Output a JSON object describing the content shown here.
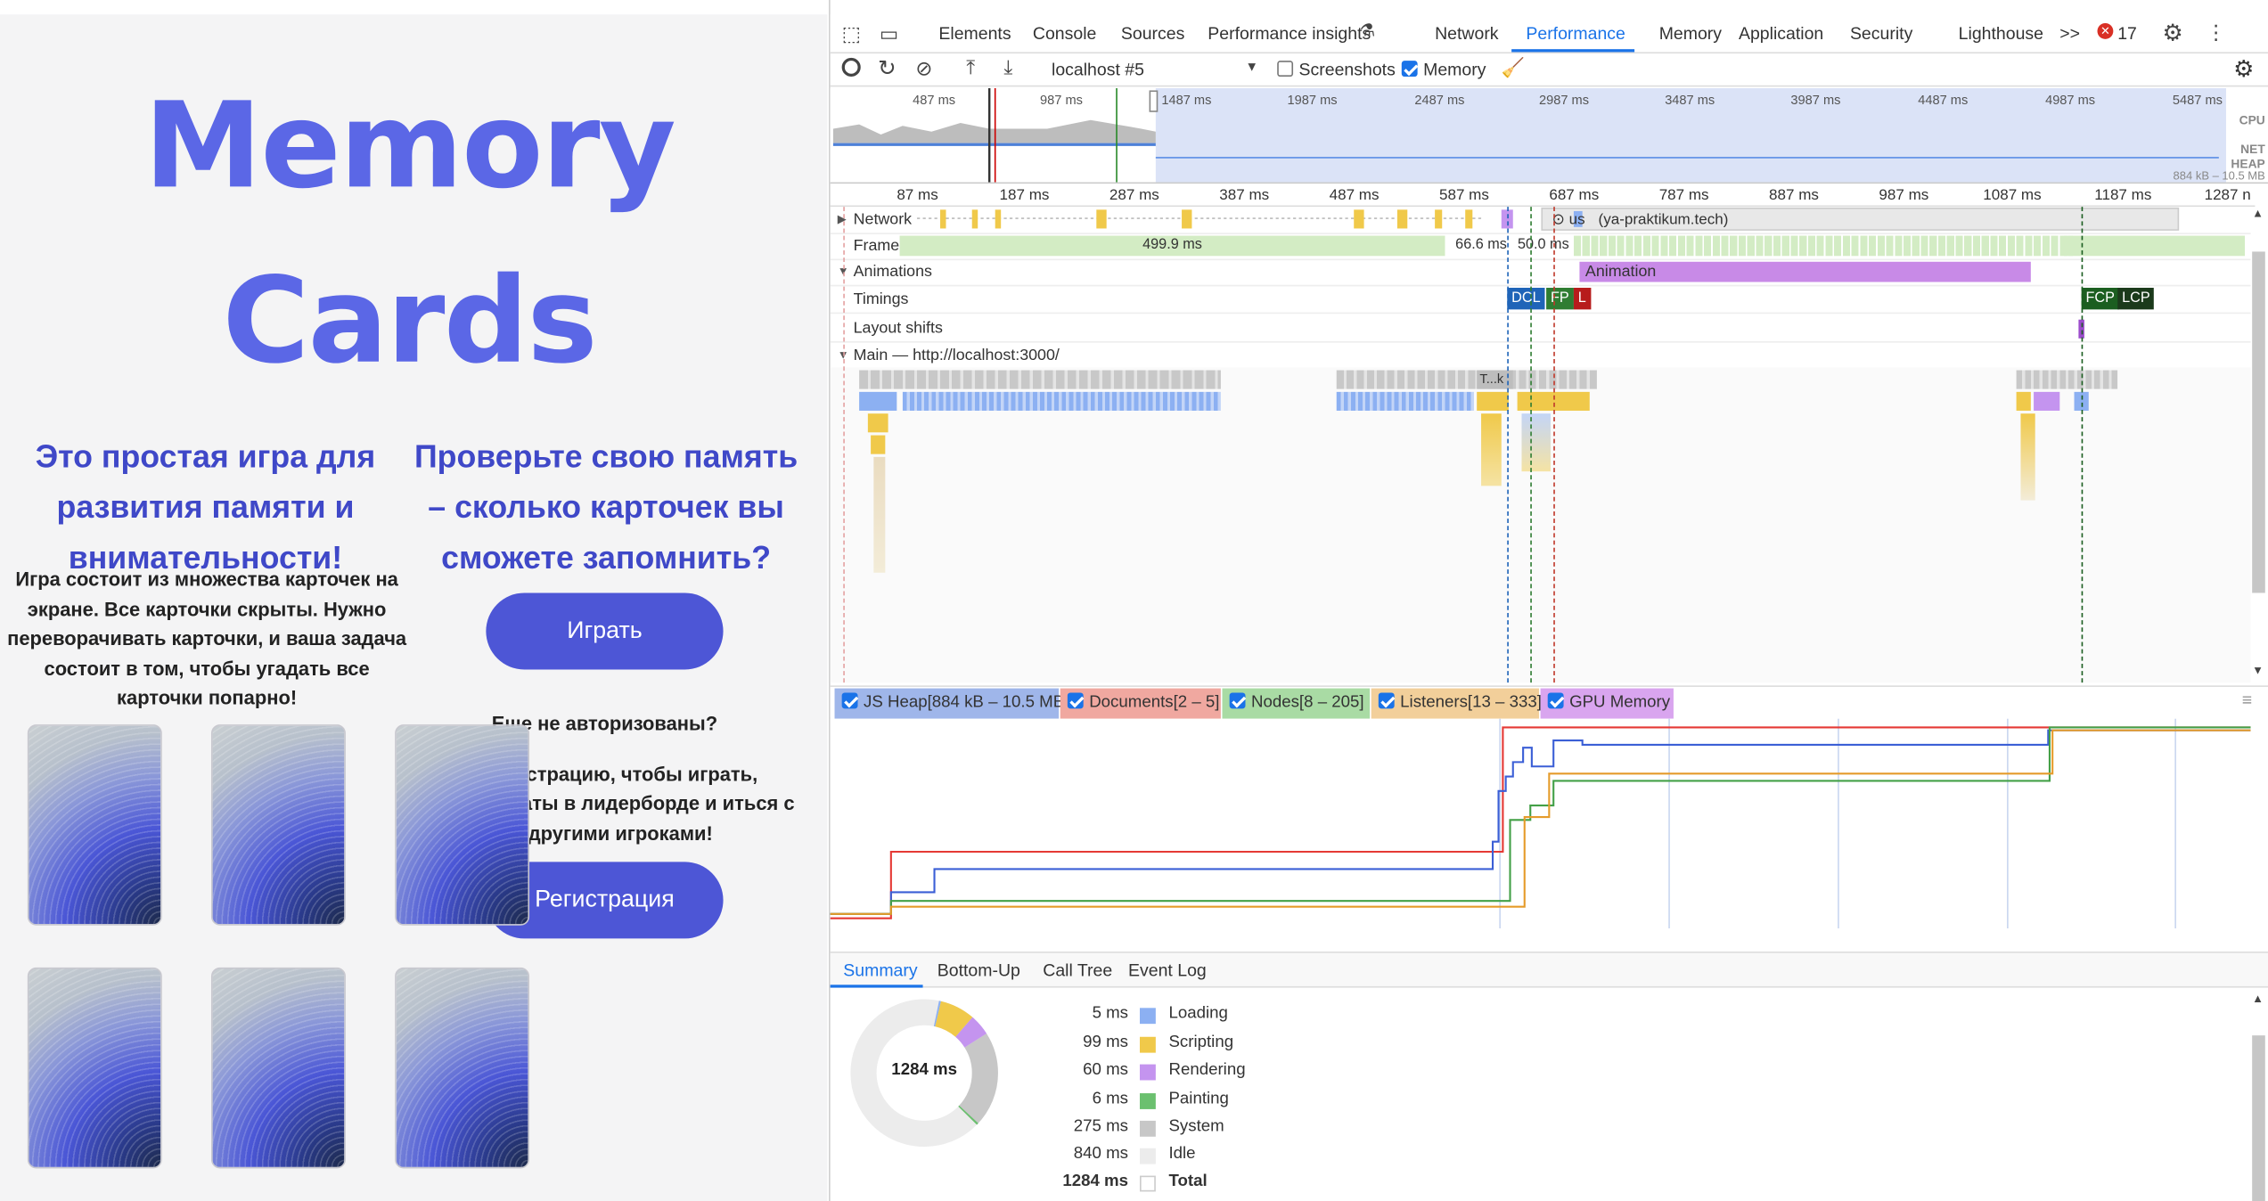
{
  "app": {
    "title_line1": "Memory",
    "title_line2": "Cards",
    "heading_left": "Это простая игра для развития памяти и внимательности!",
    "heading_right": "Проверьте свою память – сколько карточек вы сможете запомнить?",
    "description": "Игра состоит из множества карточек на экране. Все карточки скрыты. Нужно переворачивать карточки, и ваша задача состоит в том, чтобы угадать все карточки попарно!",
    "play_button": "Играть",
    "not_authorized": "Еще не авторизованы?",
    "register_prompt": "регистрацию, чтобы играть, результаты в лидерборде и иться с другими игроками!",
    "register_button": "Регистрация"
  },
  "devtools": {
    "tabs": [
      "Elements",
      "Console",
      "Sources",
      "Performance insights",
      "Network",
      "Performance",
      "Memory",
      "Application",
      "Security",
      "Lighthouse"
    ],
    "active_tab": "Performance",
    "more_tabs": ">>",
    "error_count": "17",
    "toolbar": {
      "target": "localhost #5",
      "screenshots_label": "Screenshots",
      "screenshots_checked": false,
      "memory_label": "Memory",
      "memory_checked": true
    },
    "overview": {
      "ticks": [
        "487 ms",
        "987 ms",
        "1487 ms",
        "1987 ms",
        "2487 ms",
        "2987 ms",
        "3487 ms",
        "3987 ms",
        "4487 ms",
        "4987 ms",
        "5487 ms"
      ],
      "labels": [
        "CPU",
        "NET",
        "HEAP"
      ],
      "heap_range": "884 kB – 10.5 MB"
    },
    "ruler": [
      "87 ms",
      "187 ms",
      "287 ms",
      "387 ms",
      "487 ms",
      "587 ms",
      "687 ms",
      "787 ms",
      "887 ms",
      "987 ms",
      "1087 ms",
      "1187 ms",
      "1287 n"
    ],
    "tracks": {
      "network": "Network",
      "network_item1": "us",
      "network_item2": "(ya-praktikum.tech)",
      "frames": "Frames",
      "frame_values": [
        "499.9 ms",
        "66.6 ms",
        "50.0 ms"
      ],
      "animations": "Animations",
      "animation_label": "Animation",
      "timings": "Timings",
      "timing_badges": [
        "DCL",
        "FP",
        "L",
        "FCP",
        "LCP"
      ],
      "layout_shifts": "Layout shifts",
      "main": "Main — http://localhost:3000/",
      "task_label": "T...k"
    },
    "memory_legend": [
      "JS Heap[884 kB – 10.5 MB]",
      "Documents[2 – 5]",
      "Nodes[8 – 205]",
      "Listeners[13 – 333]",
      "GPU Memory"
    ],
    "summary_tabs": [
      "Summary",
      "Bottom-Up",
      "Call Tree",
      "Event Log"
    ],
    "summary": {
      "total_center": "1284 ms",
      "rows": [
        {
          "ms": "5 ms",
          "name": "Loading",
          "color": "#8cb0f2"
        },
        {
          "ms": "99 ms",
          "name": "Scripting",
          "color": "#f0c94a"
        },
        {
          "ms": "60 ms",
          "name": "Rendering",
          "color": "#c494ef"
        },
        {
          "ms": "6 ms",
          "name": "Painting",
          "color": "#6bc06f"
        },
        {
          "ms": "275 ms",
          "name": "System",
          "color": "#c7c7c7"
        },
        {
          "ms": "840 ms",
          "name": "Idle",
          "color": "#ececec"
        },
        {
          "ms": "1284 ms",
          "name": "Total",
          "color": "#ffffff"
        }
      ]
    }
  }
}
